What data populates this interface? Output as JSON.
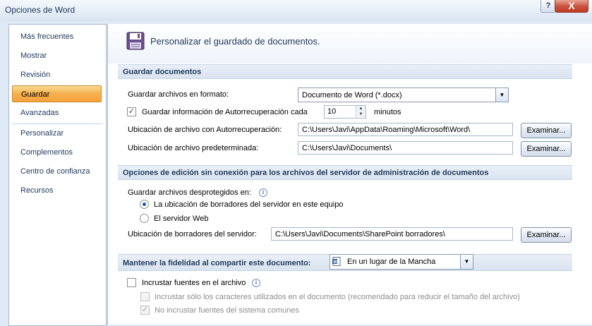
{
  "window": {
    "title": "Opciones de Word",
    "help": "?",
    "close": "X"
  },
  "nav": {
    "items": [
      {
        "label": "Más frecuentes"
      },
      {
        "label": "Mostrar"
      },
      {
        "label": "Revisión"
      },
      {
        "label": "Guardar",
        "selected": true
      },
      {
        "label": "Avanzadas"
      },
      {
        "label": "Personalizar"
      },
      {
        "label": "Complementos"
      },
      {
        "label": "Centro de confianza"
      },
      {
        "label": "Recursos"
      }
    ]
  },
  "header": {
    "title": "Personalizar el guardado de documentos.",
    "icon": "floppy-disk-icon"
  },
  "save_docs": {
    "heading": "Guardar documentos",
    "format_label": "Guardar archivos en formato:",
    "format_value": "Documento de Word (*.docx)",
    "autorecover_label": "Guardar información de Autorrecuperación cada",
    "autorecover_checked": true,
    "autorecover_minutes": "10",
    "minutes_label": "minutos",
    "autorecover_path_label": "Ubicación de archivo con Autorrecuperación:",
    "autorecover_path": "C:\\Users\\Javi\\AppData\\Roaming\\Microsoft\\Word\\",
    "default_path_label": "Ubicación de archivo predeterminada:",
    "default_path": "C:\\Users\\Javi\\Documents\\",
    "browse_label": "Examinar..."
  },
  "offline": {
    "heading": "Opciones de edición sin conexión para los archivos del servidor de administración de documentos",
    "save_to_label": "Guardar archivos desprotegidos en:",
    "option_local": "La ubicación de borradores del servidor en este equipo",
    "option_local_selected": true,
    "option_web": "El servidor Web",
    "drafts_label": "Ubicación de borradores del servidor:",
    "drafts_path": "C:\\Users\\Javi\\Documents\\SharePoint borradores\\",
    "browse_label": "Examinar..."
  },
  "fidelity": {
    "heading": "Mantener la fidelidad al compartir este documento:",
    "document": "En un lugar de la Mancha",
    "embed_fonts": "Incrustar fuentes en el archivo",
    "embed_fonts_checked": false,
    "embed_used_only": "Incrustar sólo los caracteres utilizados en el documento (recomendado para reducir el tamaño del archivo)",
    "embed_used_only_checked": false,
    "no_system_fonts": "No incrustar fuentes del sistema comunes",
    "no_system_fonts_checked": true
  }
}
